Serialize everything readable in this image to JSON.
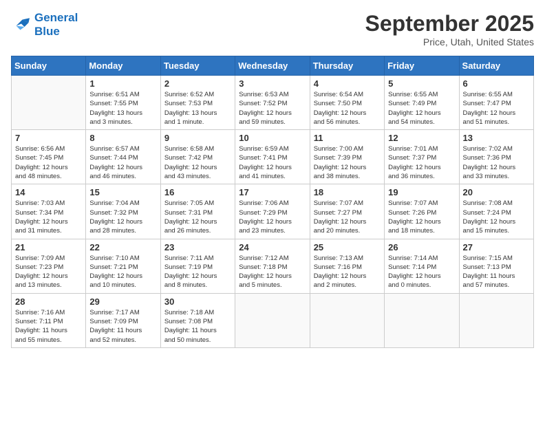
{
  "header": {
    "logo_line1": "General",
    "logo_line2": "Blue",
    "month_year": "September 2025",
    "location": "Price, Utah, United States"
  },
  "weekdays": [
    "Sunday",
    "Monday",
    "Tuesday",
    "Wednesday",
    "Thursday",
    "Friday",
    "Saturday"
  ],
  "weeks": [
    [
      {
        "day": "",
        "info": ""
      },
      {
        "day": "1",
        "info": "Sunrise: 6:51 AM\nSunset: 7:55 PM\nDaylight: 13 hours\nand 3 minutes."
      },
      {
        "day": "2",
        "info": "Sunrise: 6:52 AM\nSunset: 7:53 PM\nDaylight: 13 hours\nand 1 minute."
      },
      {
        "day": "3",
        "info": "Sunrise: 6:53 AM\nSunset: 7:52 PM\nDaylight: 12 hours\nand 59 minutes."
      },
      {
        "day": "4",
        "info": "Sunrise: 6:54 AM\nSunset: 7:50 PM\nDaylight: 12 hours\nand 56 minutes."
      },
      {
        "day": "5",
        "info": "Sunrise: 6:55 AM\nSunset: 7:49 PM\nDaylight: 12 hours\nand 54 minutes."
      },
      {
        "day": "6",
        "info": "Sunrise: 6:55 AM\nSunset: 7:47 PM\nDaylight: 12 hours\nand 51 minutes."
      }
    ],
    [
      {
        "day": "7",
        "info": "Sunrise: 6:56 AM\nSunset: 7:45 PM\nDaylight: 12 hours\nand 48 minutes."
      },
      {
        "day": "8",
        "info": "Sunrise: 6:57 AM\nSunset: 7:44 PM\nDaylight: 12 hours\nand 46 minutes."
      },
      {
        "day": "9",
        "info": "Sunrise: 6:58 AM\nSunset: 7:42 PM\nDaylight: 12 hours\nand 43 minutes."
      },
      {
        "day": "10",
        "info": "Sunrise: 6:59 AM\nSunset: 7:41 PM\nDaylight: 12 hours\nand 41 minutes."
      },
      {
        "day": "11",
        "info": "Sunrise: 7:00 AM\nSunset: 7:39 PM\nDaylight: 12 hours\nand 38 minutes."
      },
      {
        "day": "12",
        "info": "Sunrise: 7:01 AM\nSunset: 7:37 PM\nDaylight: 12 hours\nand 36 minutes."
      },
      {
        "day": "13",
        "info": "Sunrise: 7:02 AM\nSunset: 7:36 PM\nDaylight: 12 hours\nand 33 minutes."
      }
    ],
    [
      {
        "day": "14",
        "info": "Sunrise: 7:03 AM\nSunset: 7:34 PM\nDaylight: 12 hours\nand 31 minutes."
      },
      {
        "day": "15",
        "info": "Sunrise: 7:04 AM\nSunset: 7:32 PM\nDaylight: 12 hours\nand 28 minutes."
      },
      {
        "day": "16",
        "info": "Sunrise: 7:05 AM\nSunset: 7:31 PM\nDaylight: 12 hours\nand 26 minutes."
      },
      {
        "day": "17",
        "info": "Sunrise: 7:06 AM\nSunset: 7:29 PM\nDaylight: 12 hours\nand 23 minutes."
      },
      {
        "day": "18",
        "info": "Sunrise: 7:07 AM\nSunset: 7:27 PM\nDaylight: 12 hours\nand 20 minutes."
      },
      {
        "day": "19",
        "info": "Sunrise: 7:07 AM\nSunset: 7:26 PM\nDaylight: 12 hours\nand 18 minutes."
      },
      {
        "day": "20",
        "info": "Sunrise: 7:08 AM\nSunset: 7:24 PM\nDaylight: 12 hours\nand 15 minutes."
      }
    ],
    [
      {
        "day": "21",
        "info": "Sunrise: 7:09 AM\nSunset: 7:23 PM\nDaylight: 12 hours\nand 13 minutes."
      },
      {
        "day": "22",
        "info": "Sunrise: 7:10 AM\nSunset: 7:21 PM\nDaylight: 12 hours\nand 10 minutes."
      },
      {
        "day": "23",
        "info": "Sunrise: 7:11 AM\nSunset: 7:19 PM\nDaylight: 12 hours\nand 8 minutes."
      },
      {
        "day": "24",
        "info": "Sunrise: 7:12 AM\nSunset: 7:18 PM\nDaylight: 12 hours\nand 5 minutes."
      },
      {
        "day": "25",
        "info": "Sunrise: 7:13 AM\nSunset: 7:16 PM\nDaylight: 12 hours\nand 2 minutes."
      },
      {
        "day": "26",
        "info": "Sunrise: 7:14 AM\nSunset: 7:14 PM\nDaylight: 12 hours\nand 0 minutes."
      },
      {
        "day": "27",
        "info": "Sunrise: 7:15 AM\nSunset: 7:13 PM\nDaylight: 11 hours\nand 57 minutes."
      }
    ],
    [
      {
        "day": "28",
        "info": "Sunrise: 7:16 AM\nSunset: 7:11 PM\nDaylight: 11 hours\nand 55 minutes."
      },
      {
        "day": "29",
        "info": "Sunrise: 7:17 AM\nSunset: 7:09 PM\nDaylight: 11 hours\nand 52 minutes."
      },
      {
        "day": "30",
        "info": "Sunrise: 7:18 AM\nSunset: 7:08 PM\nDaylight: 11 hours\nand 50 minutes."
      },
      {
        "day": "",
        "info": ""
      },
      {
        "day": "",
        "info": ""
      },
      {
        "day": "",
        "info": ""
      },
      {
        "day": "",
        "info": ""
      }
    ]
  ]
}
